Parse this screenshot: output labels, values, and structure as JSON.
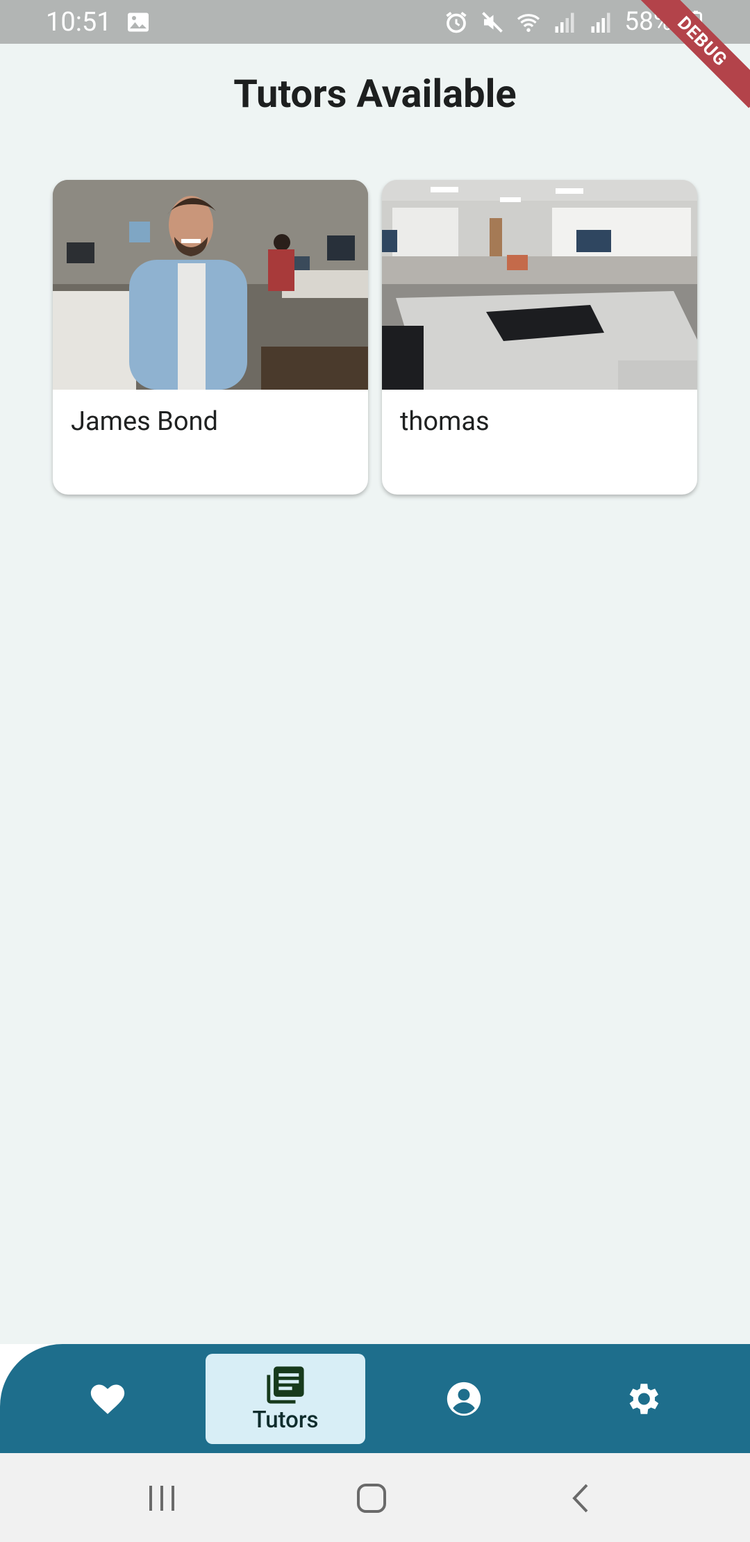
{
  "status_bar": {
    "time": "10:51",
    "battery": "58%",
    "icons": [
      "image-icon",
      "alarm-icon",
      "mute-icon",
      "wifi-icon",
      "signal-icon",
      "signal-icon",
      "battery-icon"
    ]
  },
  "debug_banner": "DEBUG",
  "page": {
    "title": "Tutors Available"
  },
  "tutors": [
    {
      "name": "James Bond"
    },
    {
      "name": "thomas"
    }
  ],
  "bottom_nav": {
    "items": [
      {
        "icon": "heart-icon",
        "label": ""
      },
      {
        "icon": "book-icon",
        "label": "Tutors",
        "selected": true
      },
      {
        "icon": "account-icon",
        "label": ""
      },
      {
        "icon": "gear-icon",
        "label": ""
      }
    ],
    "colors": {
      "bar": "#1e6e8c",
      "selected_bg": "#d8eef6"
    }
  },
  "system_nav": {
    "buttons": [
      "recents-icon",
      "home-icon",
      "back-icon"
    ]
  }
}
